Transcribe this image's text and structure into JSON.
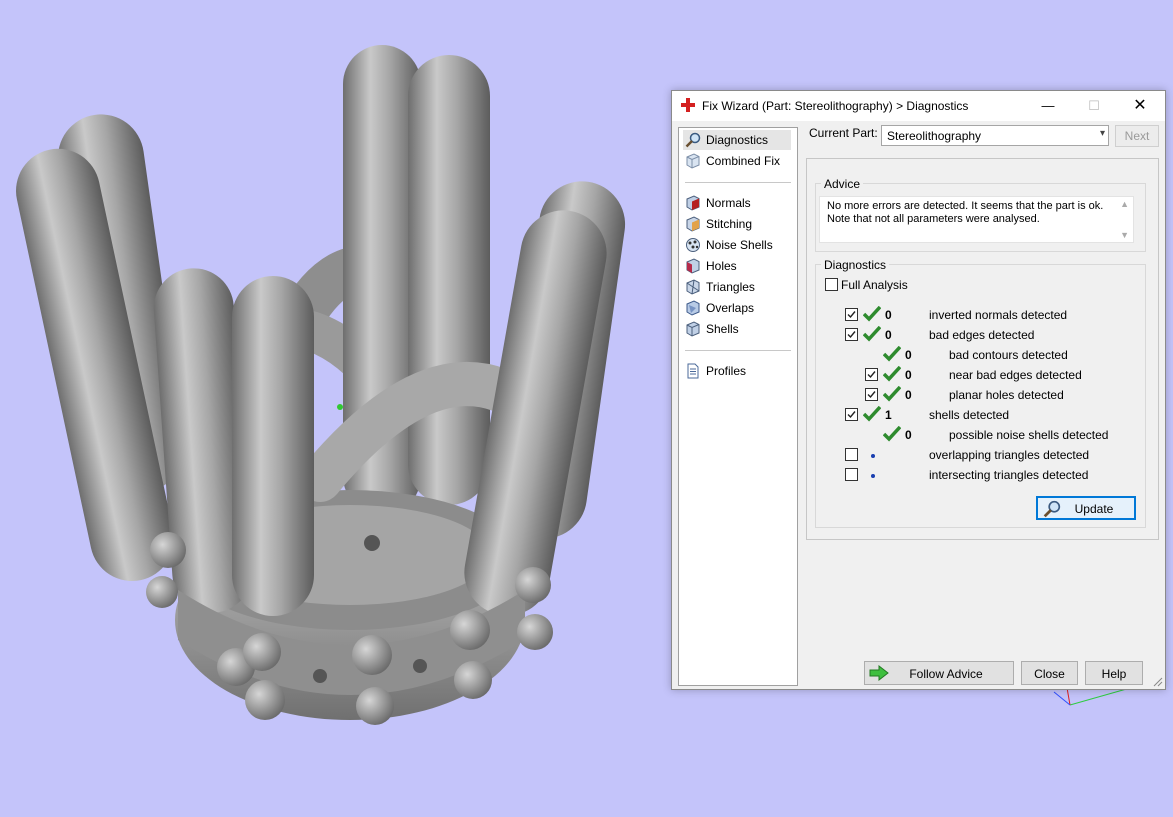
{
  "viewport": {
    "background": "#c4c4fa",
    "model_color": "#9c9c9c"
  },
  "dialog": {
    "title": "Fix Wizard (Part: Stereolithography) > Diagnostics",
    "window_controls": {
      "minimize": "—",
      "maximize": "☐",
      "close": "✕"
    },
    "nav": {
      "items": [
        {
          "label": "Diagnostics",
          "icon": "magnifier-icon",
          "selected": true
        },
        {
          "label": "Combined Fix",
          "icon": "cube-icon"
        },
        {
          "label": "Normals",
          "icon": "normals-cube-icon"
        },
        {
          "label": "Stitching",
          "icon": "stitching-cube-icon"
        },
        {
          "label": "Noise Shells",
          "icon": "noise-shells-icon"
        },
        {
          "label": "Holes",
          "icon": "holes-cube-icon"
        },
        {
          "label": "Triangles",
          "icon": "triangles-cube-icon"
        },
        {
          "label": "Overlaps",
          "icon": "overlaps-cube-icon"
        },
        {
          "label": "Shells",
          "icon": "shells-cube-icon"
        },
        {
          "label": "Profiles",
          "icon": "document-icon"
        }
      ]
    },
    "current_part_label": "Current Part:",
    "current_part_value": "Stereolithography",
    "next_label": "Next",
    "advice": {
      "title": "Advice",
      "line1": "No more errors are detected. It seems that the part is ok.",
      "line2": "Note that not all parameters were analysed."
    },
    "diagnostics": {
      "title": "Diagnostics",
      "full_analysis_label": "Full Analysis",
      "full_analysis_checked": false,
      "rows": [
        {
          "checkbox": true,
          "checked": true,
          "status": "ok",
          "count": "0",
          "label": "inverted normals detected",
          "indent": 0
        },
        {
          "checkbox": true,
          "checked": true,
          "status": "ok",
          "count": "0",
          "label": "bad edges detected",
          "indent": 0
        },
        {
          "checkbox": false,
          "checked": false,
          "status": "ok",
          "count": "0",
          "label": "bad contours detected",
          "indent": 1
        },
        {
          "checkbox": true,
          "checked": true,
          "status": "ok",
          "count": "0",
          "label": "near bad edges detected",
          "indent": 1
        },
        {
          "checkbox": true,
          "checked": true,
          "status": "ok",
          "count": "0",
          "label": "planar holes detected",
          "indent": 1
        },
        {
          "checkbox": true,
          "checked": true,
          "status": "ok",
          "count": "1",
          "label": "shells detected",
          "indent": 0
        },
        {
          "checkbox": false,
          "checked": false,
          "status": "ok",
          "count": "0",
          "label": "possible noise shells detected",
          "indent": 1
        },
        {
          "checkbox": true,
          "checked": false,
          "status": "dot",
          "count": "",
          "label": "overlapping triangles detected",
          "indent": 0
        },
        {
          "checkbox": true,
          "checked": false,
          "status": "dot",
          "count": "",
          "label": "intersecting triangles detected",
          "indent": 0
        }
      ],
      "update_label": "Update"
    },
    "buttons": {
      "follow_advice": "Follow Advice",
      "close": "Close",
      "help": "Help"
    },
    "colors": {
      "check_green": "#2e8b2e",
      "focus_blue": "#0078d7",
      "title_icon_red": "#d42020"
    }
  }
}
